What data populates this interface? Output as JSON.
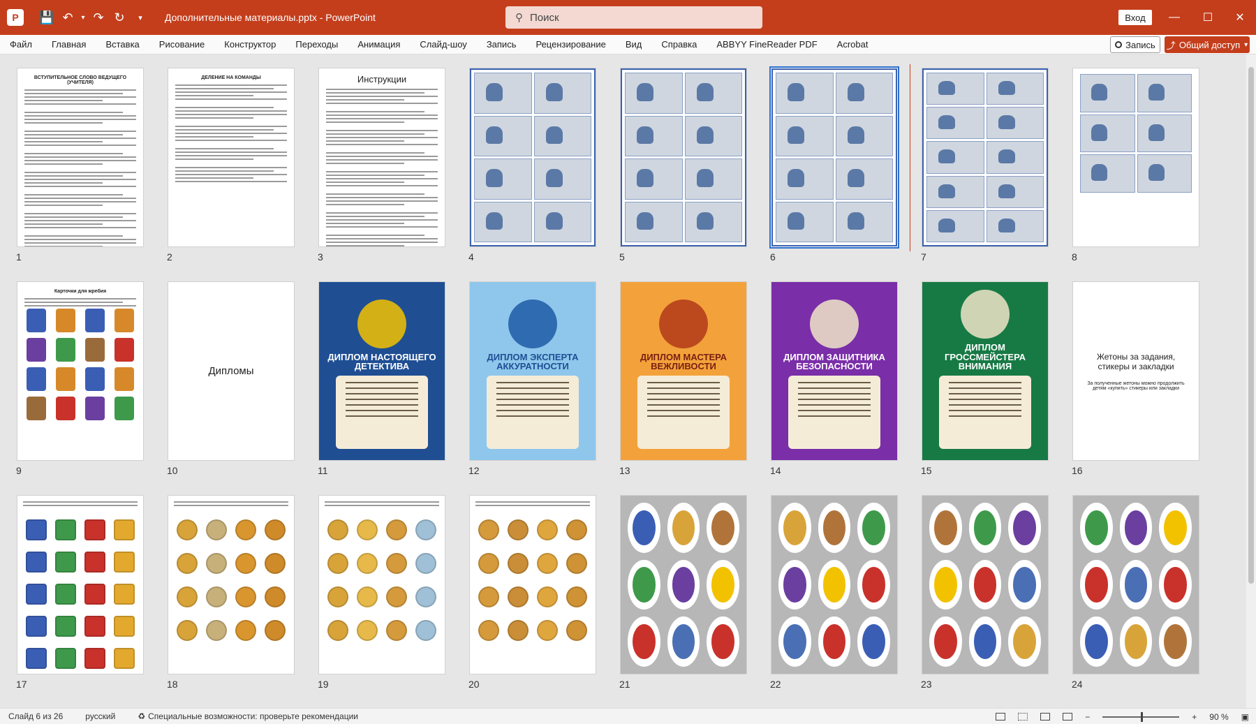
{
  "titlebar": {
    "doc_title": "Дополнительные материалы.pptx  -  PowerPoint",
    "search_placeholder": "Поиск",
    "signin": "Вход",
    "icons": [
      "app-icon",
      "save-icon",
      "undo-icon",
      "redo-icon",
      "repeat-icon",
      "customize-icon",
      "search-icon",
      "minimize-icon",
      "maximize-icon",
      "close-icon"
    ]
  },
  "ribbon": {
    "tabs": [
      "Файл",
      "Главная",
      "Вставка",
      "Рисование",
      "Конструктор",
      "Переходы",
      "Анимация",
      "Слайд-шоу",
      "Запись",
      "Рецензирование",
      "Вид",
      "Справка",
      "ABBYY FineReader PDF",
      "Acrobat"
    ],
    "record": "Запись",
    "share": "Общий доступ"
  },
  "slides": [
    {
      "num": "1",
      "kind": "doc",
      "title": "ВСТУПИТЕЛЬНОЕ СЛОВО ВЕДУЩЕГО (УЧИТЕЛЯ)"
    },
    {
      "num": "2",
      "kind": "doc",
      "title": "ДЕЛЕНИЕ НА КОМАНДЫ"
    },
    {
      "num": "3",
      "kind": "doc",
      "title": "Инструкции"
    },
    {
      "num": "4",
      "kind": "grid"
    },
    {
      "num": "5",
      "kind": "grid"
    },
    {
      "num": "6",
      "kind": "grid",
      "selected": true
    },
    {
      "num": "7",
      "kind": "grid"
    },
    {
      "num": "8",
      "kind": "doc2"
    },
    {
      "num": "9",
      "kind": "cards",
      "title": "Карточки для жребия"
    },
    {
      "num": "10",
      "kind": "text",
      "text": "Дипломы"
    },
    {
      "num": "11",
      "kind": "diploma",
      "title": "ДИПЛОМ НАСТОЯЩЕГО ДЕТЕКТИВА",
      "bg": "#1f4e93",
      "accent": "#f2c200"
    },
    {
      "num": "12",
      "kind": "diploma",
      "title": "ДИПЛОМ ЭКСПЕРТА АККУРАТНОСТИ",
      "bg": "#8fc7ec",
      "accent": "#1f5aa6"
    },
    {
      "num": "13",
      "kind": "diploma",
      "title": "ДИПЛОМ МАСТЕРА ВЕЖЛИВОСТИ",
      "bg": "#f3a23b",
      "accent": "#b23a1a"
    },
    {
      "num": "14",
      "kind": "diploma",
      "title": "ДИПЛОМ ЗАЩИТНИКА БЕЗОПАСНОСТИ",
      "bg": "#7a2ea8",
      "accent": "#f0e5c8"
    },
    {
      "num": "15",
      "kind": "diploma",
      "title": "ДИПЛОМ ГРОССМЕЙСТЕРА ВНИМАНИЯ",
      "bg": "#177a45",
      "accent": "#f0e5c8"
    },
    {
      "num": "16",
      "kind": "text",
      "text": "Жетоны за задания, стикеры и закладки",
      "sub": "За полученные жетоны можно продолжить детям «купить» стикеры или закладки"
    },
    {
      "num": "17",
      "kind": "tokens",
      "shape": "sq",
      "palette": [
        "#3b5eb5",
        "#3e9a4a",
        "#c8322b",
        "#e3a92e"
      ]
    },
    {
      "num": "18",
      "kind": "tokens",
      "shape": "round",
      "palette": [
        "#d8a43a",
        "#c7b07a",
        "#d9962e",
        "#cf8a2a"
      ]
    },
    {
      "num": "19",
      "kind": "tokens",
      "shape": "round",
      "palette": [
        "#d8a43a",
        "#e6b94a",
        "#d49a3c",
        "#9fc0d6"
      ]
    },
    {
      "num": "20",
      "kind": "tokens",
      "shape": "round",
      "palette": [
        "#d49a3c",
        "#c98e37",
        "#e0a63e",
        "#cf9235"
      ]
    },
    {
      "num": "21",
      "kind": "stickers"
    },
    {
      "num": "22",
      "kind": "stickers"
    },
    {
      "num": "23",
      "kind": "stickers"
    },
    {
      "num": "24",
      "kind": "stickers"
    }
  ],
  "status": {
    "slide": "Слайд 6 из 26",
    "lang": "русский",
    "a11y": "Специальные возможности: проверьте рекомендации",
    "zoom": "90 %"
  },
  "colors": {
    "brand": "#c43e1c",
    "select": "#2b6fce"
  }
}
